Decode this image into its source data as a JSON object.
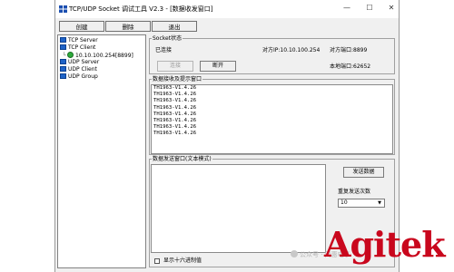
{
  "window": {
    "title": "TCP/UDP Socket 调试工具 V2.3 - [数据收发窗口]",
    "controls": {
      "minimize": "—",
      "maximize": "☐",
      "close": "✕"
    }
  },
  "toolbar": {
    "create": "创建",
    "delete": "删除",
    "exit": "退出"
  },
  "tree": {
    "tcp_server": "TCP Server",
    "tcp_client": "TCP Client",
    "tcp_client_conn": "10.10.100.254[8899]",
    "udp_server": "UDP Server",
    "udp_client": "UDP Client",
    "udp_group": "UDP Group"
  },
  "socket_status": {
    "title": "Socket状态",
    "connected": "已连接",
    "peer_ip": "对方IP:10.10.100.254",
    "peer_port": "对方端口:8899",
    "local_port": "本地端口:62652",
    "connect_btn": "连接",
    "disconnect_btn": "断开"
  },
  "receive": {
    "title": "数据接收及提示窗口",
    "lines": [
      "TH1963-V1.4.26",
      "TH1963-V1.4.26",
      "TH1963-V1.4.26",
      "TH1963-V1.4.26",
      "TH1963-V1.4.26",
      "TH1963-V1.4.26",
      "TH1963-V1.4.26",
      "TH1963-V1.4.26"
    ]
  },
  "send": {
    "title": "数据发送窗口(文本模式)",
    "send_btn": "发送数据",
    "repeat_label": "重复发送次数",
    "repeat_value": "10",
    "hex_label": "显示十六进制值"
  },
  "watermark": "公众号 · 同惠电子",
  "logo": "Agitek"
}
